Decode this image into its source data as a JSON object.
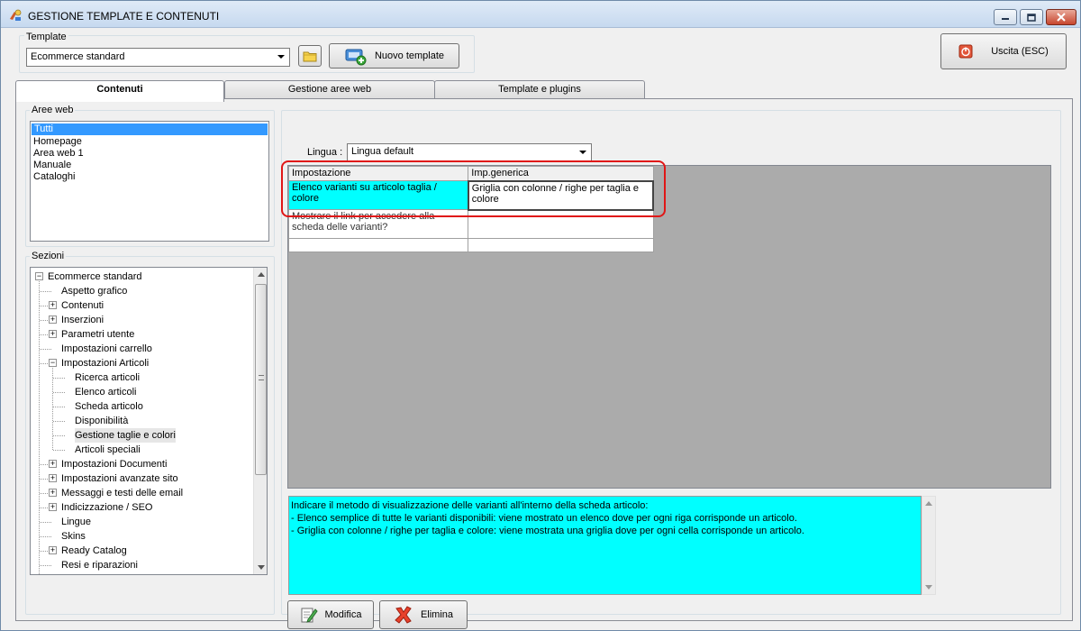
{
  "window": {
    "title": "GESTIONE TEMPLATE E CONTENUTI",
    "controls": {
      "minimize": "minimize",
      "maximize": "maximize",
      "close": "close"
    }
  },
  "toolbar": {
    "template_label": "Template",
    "template_value": "Ecommerce standard",
    "new_template_label": "Nuovo template",
    "exit_label": "Uscita (ESC)"
  },
  "tabs": [
    {
      "label": "Contenuti",
      "active": true
    },
    {
      "label": "Gestione aree web",
      "active": false
    },
    {
      "label": "Template e plugins",
      "active": false
    }
  ],
  "aree_web": {
    "title": "Aree web",
    "items": [
      "Tutti",
      "Homepage",
      "Area web 1",
      "Manuale",
      "Cataloghi"
    ],
    "selected": "Tutti"
  },
  "sezioni": {
    "title": "Sezioni",
    "items": [
      {
        "label": "Ecommerce standard",
        "level": 0,
        "expander": "minus"
      },
      {
        "label": "Aspetto grafico",
        "level": 1,
        "expander": ""
      },
      {
        "label": "Contenuti",
        "level": 1,
        "expander": "plus"
      },
      {
        "label": "Inserzioni",
        "level": 1,
        "expander": "plus"
      },
      {
        "label": "Parametri utente",
        "level": 1,
        "expander": "plus"
      },
      {
        "label": "Impostazioni carrello",
        "level": 1,
        "expander": ""
      },
      {
        "label": "Impostazioni Articoli",
        "level": 1,
        "expander": "minus"
      },
      {
        "label": "Ricerca articoli",
        "level": 2,
        "expander": ""
      },
      {
        "label": "Elenco articoli",
        "level": 2,
        "expander": ""
      },
      {
        "label": "Scheda articolo",
        "level": 2,
        "expander": ""
      },
      {
        "label": "Disponibilità",
        "level": 2,
        "expander": ""
      },
      {
        "label": "Gestione taglie e colori",
        "level": 2,
        "expander": "",
        "highlight": true
      },
      {
        "label": "Articoli speciali",
        "level": 2,
        "expander": ""
      },
      {
        "label": "Impostazioni Documenti",
        "level": 1,
        "expander": "plus"
      },
      {
        "label": "Impostazioni avanzate sito",
        "level": 1,
        "expander": "plus"
      },
      {
        "label": "Messaggi e testi delle email",
        "level": 1,
        "expander": "plus"
      },
      {
        "label": "Indicizzazione / SEO",
        "level": 1,
        "expander": "plus"
      },
      {
        "label": "Lingue",
        "level": 1,
        "expander": ""
      },
      {
        "label": "Skins",
        "level": 1,
        "expander": ""
      },
      {
        "label": "Ready Catalog",
        "level": 1,
        "expander": "plus"
      },
      {
        "label": "Resi e riparazioni",
        "level": 1,
        "expander": ""
      }
    ]
  },
  "lingua": {
    "label": "Lingua :",
    "value": "Lingua default"
  },
  "grid": {
    "headers": [
      "Impostazione",
      "Imp.generica"
    ],
    "rows": [
      {
        "setting": "Elenco varianti su articolo taglia / colore",
        "value": "Griglia con colonne / righe per taglia e colore"
      },
      {
        "setting": "Mostrare il link per accedere alla scheda delle varianti?",
        "value": ""
      },
      {
        "setting": "",
        "value": ""
      }
    ]
  },
  "description": {
    "text": "Indicare il metodo di visualizzazione delle varianti all'interno della scheda articolo:\n- Elenco semplice di tutte le varianti disponibili: viene mostrato un elenco dove per ogni riga corrisponde un articolo.\n- Griglia con colonne / righe per taglia e colore: viene mostrata una griglia dove per ogni cella corrisponde un articolo."
  },
  "actions": {
    "edit_label": "Modifica",
    "delete_label": "Elimina"
  },
  "colors": {
    "accent_selection": "#3399ff",
    "highlight_cell": "#00ffff",
    "annotation": "#e01616"
  }
}
